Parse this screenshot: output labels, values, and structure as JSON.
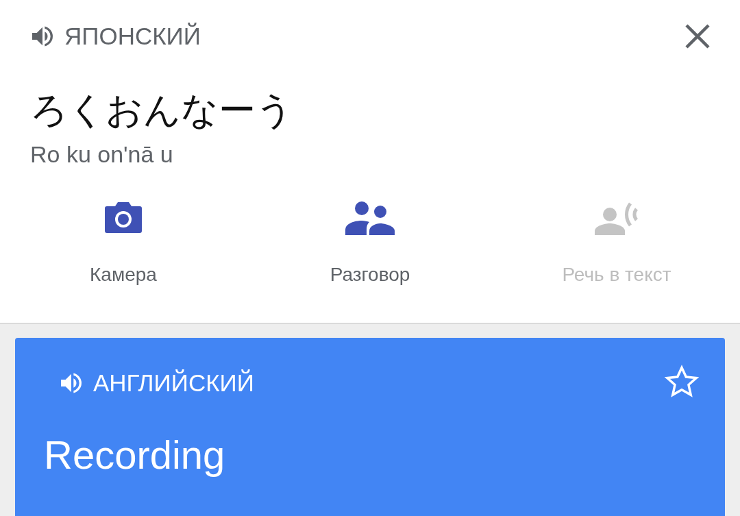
{
  "source": {
    "language": "ЯПОНСКИЙ",
    "text": "ろくおんなーう",
    "romanization": "Ro ku on'nā u"
  },
  "actions": [
    {
      "kind": "camera",
      "label": "Камера",
      "disabled": false
    },
    {
      "kind": "conversation",
      "label": "Разговор",
      "disabled": false
    },
    {
      "kind": "speech",
      "label": "Речь в текст",
      "disabled": true
    }
  ],
  "result": {
    "language": "АНГЛИЙСКИЙ",
    "text": "Recording",
    "starred": false
  }
}
